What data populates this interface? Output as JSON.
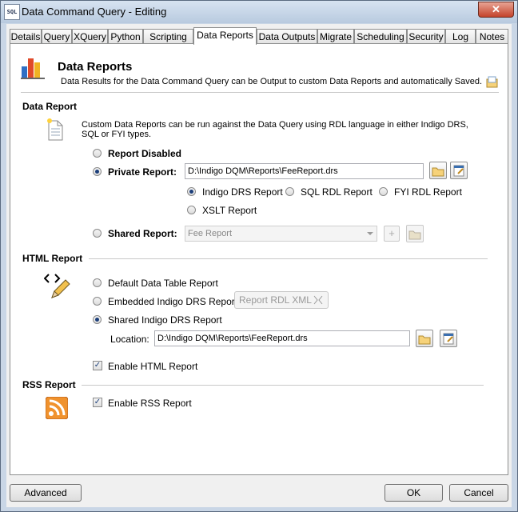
{
  "window": {
    "title": "Data Command Query - Editing",
    "app_icon_text": "SQL",
    "close": "✕"
  },
  "tabs": [
    "Details",
    "Query",
    "XQuery",
    "Python",
    "Scripting",
    "Data Reports",
    "Data Outputs",
    "Migrate",
    "Scheduling",
    "Security",
    "Log",
    "Notes"
  ],
  "header": {
    "title": "Data Reports",
    "description": "Data Results for the Data Command Query can be Output to custom Data Reports and automatically Saved."
  },
  "data_report": {
    "section": "Data Report",
    "description": "Custom Data Reports can be run against the Data Query using RDL language in either Indigo DRS, SQL or FYI types.",
    "report_disabled": "Report Disabled",
    "private_report": "Private Report:",
    "private_report_path": "D:\\Indigo DQM\\Reports\\FeeReport.drs",
    "types": [
      "Indigo DRS Report",
      "SQL RDL Report",
      "FYI RDL Report",
      "XSLT Report"
    ],
    "shared_report": "Shared Report:",
    "shared_report_value": "Fee Report",
    "add_symbol": "+"
  },
  "html_report": {
    "section": "HTML Report",
    "options": [
      "Default Data Table Report",
      "Embedded Indigo DRS Report",
      "Shared Indigo DRS Report"
    ],
    "rdl_xml_button": "Report RDL XML",
    "location_label": "Location:",
    "location_value": "D:\\Indigo DQM\\Reports\\FeeReport.drs",
    "enable": "Enable HTML Report",
    "enabled": true
  },
  "rss_report": {
    "section": "RSS Report",
    "enable": "Enable RSS Report",
    "enabled": true
  },
  "footer": {
    "advanced": "Advanced",
    "ok": "OK",
    "cancel": "Cancel"
  },
  "colors": {
    "accent": "#1c3f7a",
    "rss": "#f0922d",
    "window_frame": "#c9d6e6"
  }
}
